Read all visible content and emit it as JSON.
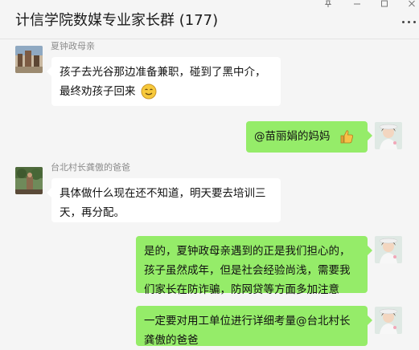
{
  "window": {
    "title": "计信学院数媒专业家长群 (177)",
    "more_icon": "more-dots-icon",
    "controls": [
      "pin-icon",
      "minimize-icon",
      "maximize-icon",
      "close-icon"
    ]
  },
  "messages": [
    {
      "sender": "夏钟政母亲",
      "direction": "incoming",
      "text": "孩子去光谷那边准备兼职，碰到了黑中介，最终劝孩子回来",
      "emoji": "smile-face-emoji"
    },
    {
      "sender": "",
      "direction": "outgoing",
      "text": "@苗丽娟的妈妈",
      "emoji": "thumbs-up-emoji"
    },
    {
      "sender": "台北村长龚傲的爸爸",
      "direction": "incoming",
      "text": "具体做什么现在还不知道，明天要去培训三天，再分配。"
    },
    {
      "sender": "",
      "direction": "outgoing",
      "text": "是的，夏钟政母亲遇到的正是我们担心的，孩子虽然成年，但是社会经验尚浅，需要我们家长在防诈骗，防网贷等方面多加注意"
    },
    {
      "sender": "",
      "direction": "outgoing",
      "text": "一定要对用工单位进行详细考量@台北村长龚傲的爸爸"
    }
  ],
  "colors": {
    "background": "#f5f5f5",
    "incoming_bubble": "#ffffff",
    "outgoing_bubble": "#95ec69",
    "sender_name": "#8c8c8c"
  }
}
